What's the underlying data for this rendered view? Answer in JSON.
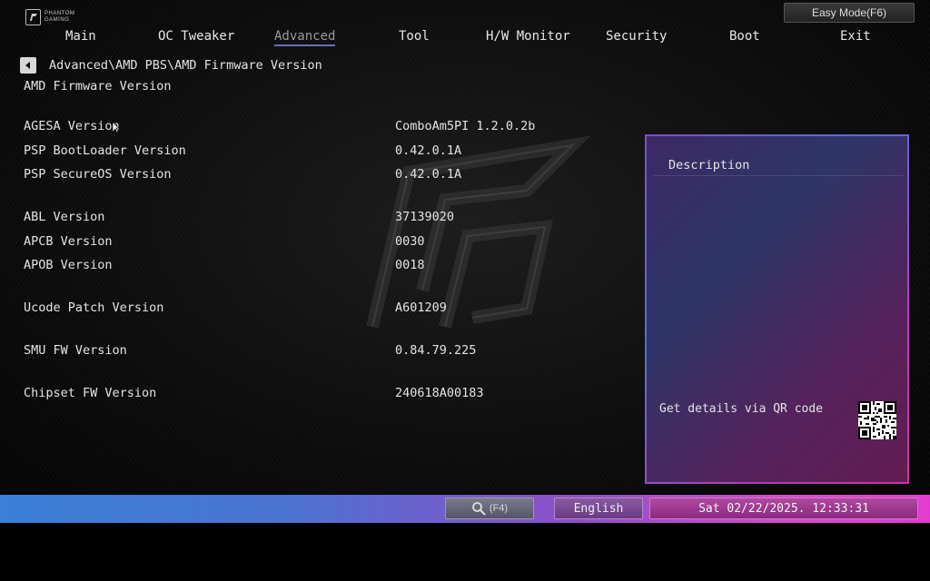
{
  "brand": {
    "logo_text": "PHANTOM GAMING"
  },
  "header": {
    "easy_mode_label": "Easy Mode(F6)"
  },
  "tabs": [
    {
      "label": "Main"
    },
    {
      "label": "OC Tweaker"
    },
    {
      "label": "Advanced",
      "active": true
    },
    {
      "label": "Tool"
    },
    {
      "label": "H/W Monitor"
    },
    {
      "label": "Security"
    },
    {
      "label": "Boot"
    },
    {
      "label": "Exit"
    }
  ],
  "breadcrumb": "Advanced\\AMD PBS\\AMD Firmware Version",
  "page_title": "AMD Firmware Version",
  "rows": [
    {
      "label": "AGESA Version",
      "value": "ComboAm5PI 1.2.0.2b"
    },
    {
      "label": "PSP BootLoader Version",
      "value": "0.42.0.1A"
    },
    {
      "label": "PSP SecureOS Version",
      "value": "0.42.0.1A"
    },
    {
      "label": "ABL Version",
      "value": "37139020"
    },
    {
      "label": "APCB Version",
      "value": "0030"
    },
    {
      "label": "APOB Version",
      "value": "0018"
    },
    {
      "label": "Ucode Patch Version",
      "value": "A601209"
    },
    {
      "label": "SMU FW Version",
      "value": "0.84.79.225"
    },
    {
      "label": "Chipset FW Version",
      "value": "240618A00183"
    }
  ],
  "description": {
    "title": "Description",
    "qr_text": "Get details via QR code"
  },
  "footer": {
    "search_label": "(F4)",
    "language": "English",
    "datetime": "Sat 02/22/2025. 12:33:31"
  },
  "colors": {
    "accent_tab_underline": "#6c6cb8",
    "bar_left": "#3a7fd8",
    "bar_right": "#e63bd0"
  },
  "icons": {
    "back": "left-arrow-icon",
    "search": "magnifier-icon",
    "qr": "qr-code-icon",
    "cursor": "mouse-pointer-icon"
  }
}
